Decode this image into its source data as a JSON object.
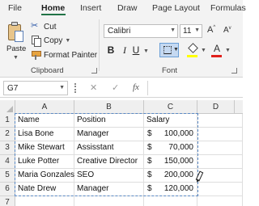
{
  "menu": {
    "tabs": [
      "File",
      "Home",
      "Insert",
      "Draw",
      "Page Layout",
      "Formulas"
    ],
    "active": "Home"
  },
  "clipboard": {
    "paste_label": "Paste",
    "cut_label": "Cut",
    "copy_label": "Copy",
    "format_painter_label": "Format Painter",
    "group_label": "Clipboard"
  },
  "font": {
    "name": "Calibri",
    "size": "11",
    "grow_label": "A",
    "shrink_label": "A",
    "bold_label": "B",
    "italic_label": "I",
    "underline_label": "U",
    "font_color_label": "A",
    "group_label": "Font",
    "fill_color": "#ffff00",
    "font_color": "#e0201b"
  },
  "formula_bar": {
    "name_box": "G7",
    "cancel_glyph": "✕",
    "enter_glyph": "✓",
    "fx_label": "fx",
    "formula": ""
  },
  "sheet": {
    "columns": [
      "A",
      "B",
      "C",
      "D"
    ],
    "rows": [
      "1",
      "2",
      "3",
      "4",
      "5",
      "6",
      "7"
    ],
    "header": [
      "Name",
      "Position",
      "Salary"
    ],
    "data": [
      [
        "Lisa Bone",
        "Manager",
        "$",
        "100,000"
      ],
      [
        "Mike Stewart",
        "Assisstant",
        "$",
        "70,000"
      ],
      [
        "Luke Potter",
        "Creative Director",
        "$",
        "150,000"
      ],
      [
        "Maria Gonzales",
        "SEO",
        "$",
        "200,000"
      ],
      [
        "Nate Drew",
        "Manager",
        "$",
        "120,000"
      ]
    ],
    "marquee_color": "#5b8ac6"
  }
}
